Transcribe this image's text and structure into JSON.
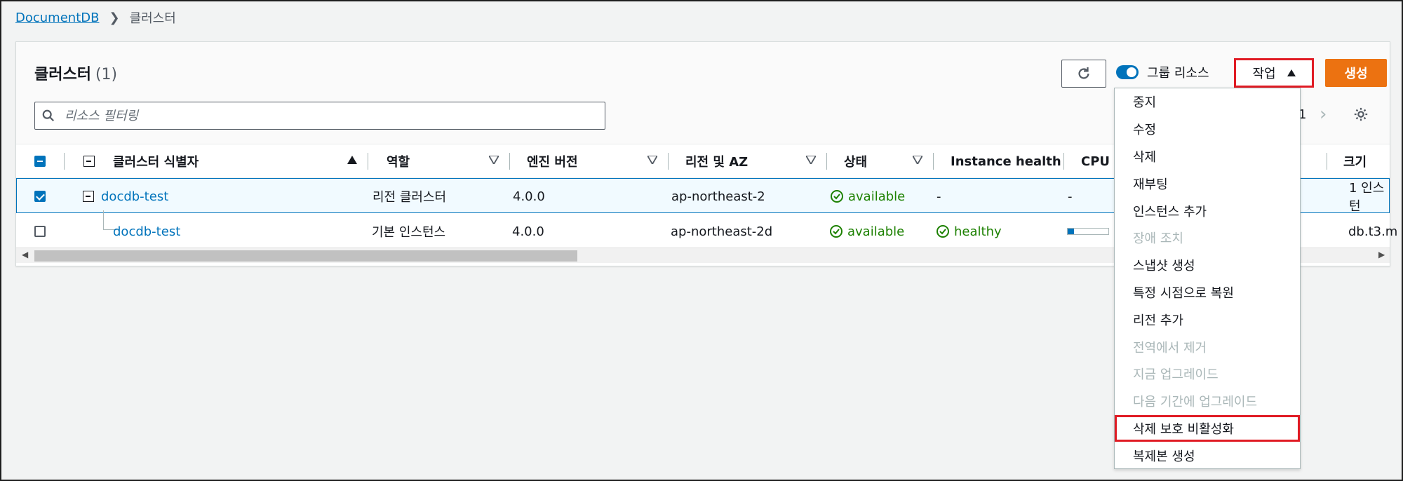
{
  "breadcrumb": {
    "root": "DocumentDB",
    "current": "클러스터"
  },
  "header": {
    "title": "클러스터",
    "count": "(1)",
    "group_toggle_label": "그룹 리소스",
    "actions_label": "작업",
    "create_label": "생성",
    "page_number": "1"
  },
  "filter": {
    "placeholder": "리소스 필터링"
  },
  "columns": [
    "클러스터 식별자",
    "역할",
    "엔진 버전",
    "리전 및 AZ",
    "상태",
    "Instance health",
    "CPU",
    "크기"
  ],
  "rows": [
    {
      "id": "docdb-test",
      "role": "리전 클러스터",
      "engine": "4.0.0",
      "region": "ap-northeast-2",
      "status": "available",
      "health": "-",
      "cpu": "-",
      "size": "1 인스턴",
      "selected": true
    },
    {
      "id": "docdb-test",
      "role": "기본 인스턴스",
      "engine": "4.0.0",
      "region": "ap-northeast-2d",
      "status": "available",
      "health": "healthy",
      "cpu_fraction": 0.15,
      "size": "db.t3.m",
      "selected": false
    }
  ],
  "actions_menu": [
    {
      "label": "중지",
      "disabled": false
    },
    {
      "label": "수정",
      "disabled": false
    },
    {
      "label": "삭제",
      "disabled": false
    },
    {
      "label": "재부팅",
      "disabled": false
    },
    {
      "label": "인스턴스 추가",
      "disabled": false
    },
    {
      "label": "장애 조치",
      "disabled": true
    },
    {
      "label": "스냅샷 생성",
      "disabled": false
    },
    {
      "label": "특정 시점으로 복원",
      "disabled": false
    },
    {
      "label": "리전 추가",
      "disabled": false
    },
    {
      "label": "전역에서 제거",
      "disabled": true
    },
    {
      "label": "지금 업그레이드",
      "disabled": true
    },
    {
      "label": "다음 기간에 업그레이드",
      "disabled": true
    },
    {
      "label": "삭제 보호 비활성화",
      "disabled": false,
      "highlighted": true
    },
    {
      "label": "복제본 생성",
      "disabled": false
    }
  ],
  "colors": {
    "link": "#0073bb",
    "primary": "#ec7211",
    "highlight": "#e01b24",
    "ok": "#1d8102"
  }
}
